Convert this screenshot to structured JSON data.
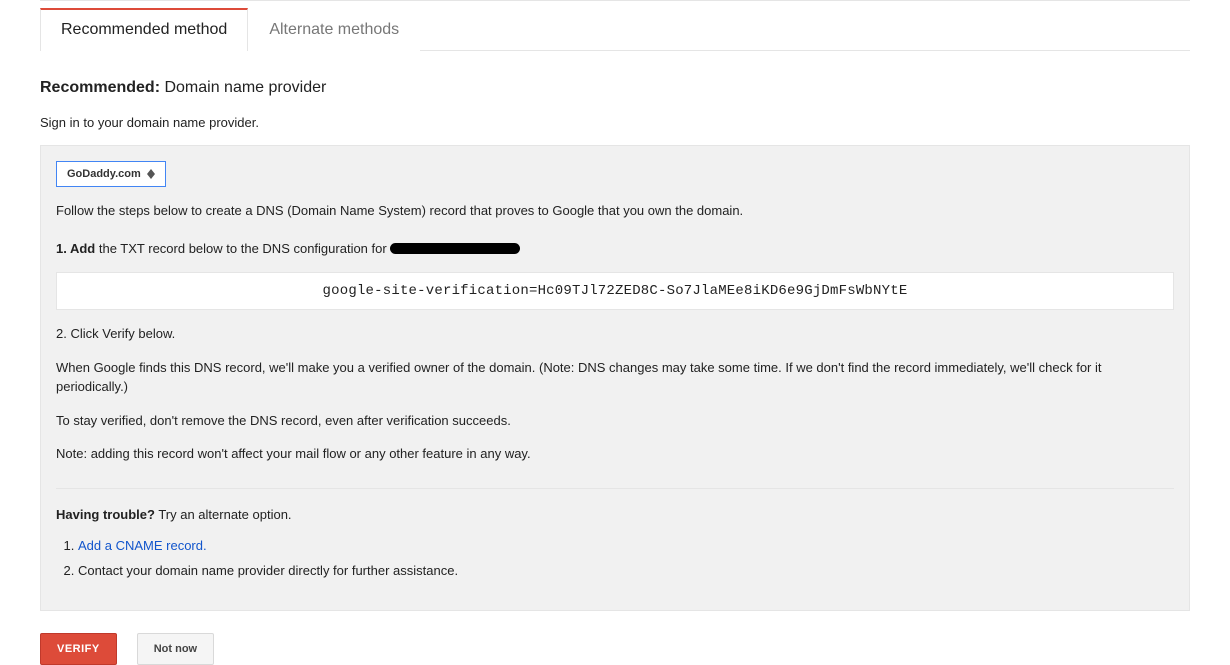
{
  "tabs": {
    "recommended": "Recommended method",
    "alternate": "Alternate methods"
  },
  "heading_bold": "Recommended:",
  "heading_rest": " Domain name provider",
  "subhead": "Sign in to your domain name provider.",
  "provider_selected": "GoDaddy.com",
  "follow_steps": "Follow the steps below to create a DNS (Domain Name System) record that proves to Google that you own the domain.",
  "step1_num_bold": "1. Add",
  "step1_rest": " the TXT record below to the DNS configuration for ",
  "txt_record": "google-site-verification=Hc09TJl72ZED8C-So7JlaMEe8iKD6e9GjDmFsWbNYtE",
  "step2_pre": "2. Click ",
  "step2_bold": "Verify",
  "step2_post": " below.",
  "note_find": "When Google finds this DNS record, we'll make you a verified owner of the domain. (Note: DNS changes may take some time. If we don't find the record immediately, we'll check for it periodically.)",
  "note_stay": "To stay verified, don't remove the DNS record, even after verification succeeds.",
  "note_label": "Note:",
  "note_mail": " adding this record won't affect your mail flow or any other feature in any way.",
  "trouble_bold": "Having trouble?",
  "trouble_rest": " Try an alternate option.",
  "trouble_opt1": "Add a CNAME record.",
  "trouble_opt2": "Contact your domain name provider directly for further assistance.",
  "verify_btn": "VERIFY",
  "notnow_btn": "Not now"
}
